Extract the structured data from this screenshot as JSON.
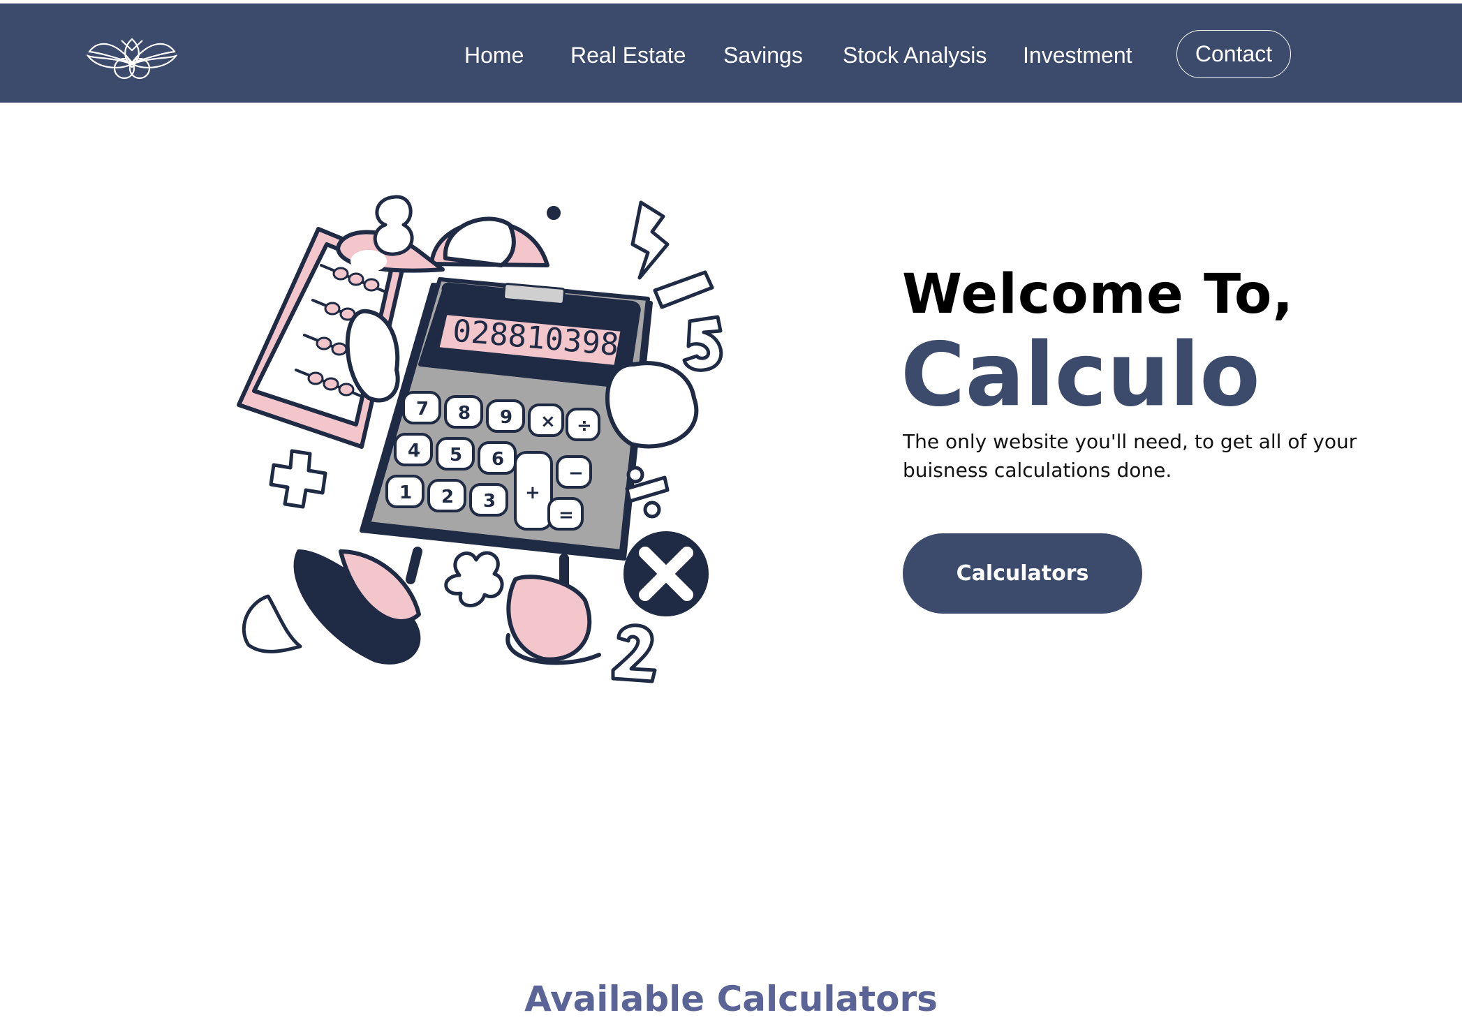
{
  "nav": {
    "logo_icon": "lotus-logo-icon",
    "links": [
      "Home",
      "Real Estate",
      "Savings",
      "Stock Analysis",
      "Investment"
    ],
    "contact_label": "Contact"
  },
  "hero": {
    "illustration_icon": "calculator-mascot-illustration",
    "calculator_display": "028810398",
    "heading_line1": "Welcome To,",
    "heading_line2": "Calculo",
    "description": "The only website you'll need, to get all of your buisness calculations done.",
    "cta_label": "Calculators"
  },
  "section": {
    "title": "Available Calculators"
  },
  "colors": {
    "navy": "#3c4a6b",
    "pink": "#f3c6cc",
    "gray": "#9e9e9e",
    "section_title": "#5b6497"
  }
}
